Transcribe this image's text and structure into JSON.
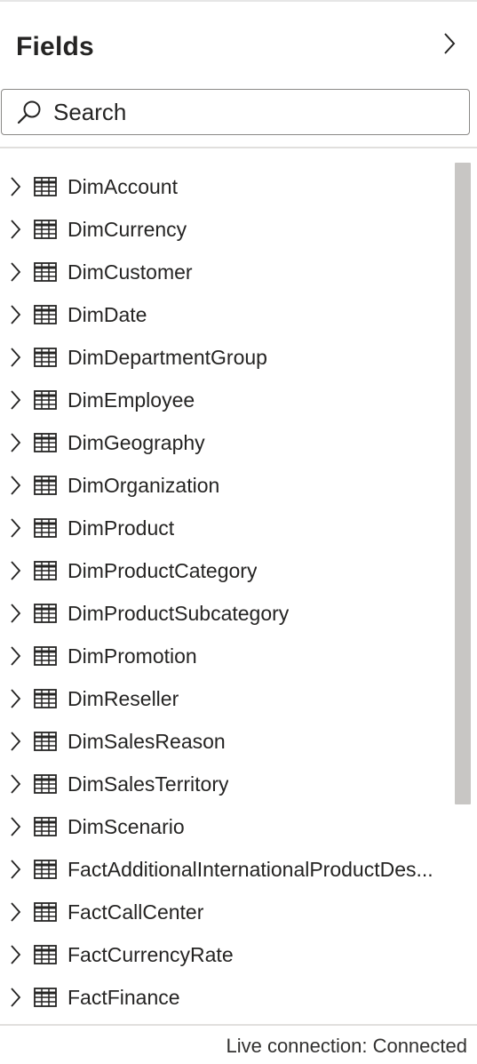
{
  "pane": {
    "title": "Fields",
    "collapse_icon": "chevron-right-icon"
  },
  "search": {
    "placeholder": "Search",
    "icon": "search-icon"
  },
  "tables": [
    {
      "name": "DimAccount"
    },
    {
      "name": "DimCurrency"
    },
    {
      "name": "DimCustomer"
    },
    {
      "name": "DimDate"
    },
    {
      "name": "DimDepartmentGroup"
    },
    {
      "name": "DimEmployee"
    },
    {
      "name": "DimGeography"
    },
    {
      "name": "DimOrganization"
    },
    {
      "name": "DimProduct"
    },
    {
      "name": "DimProductCategory"
    },
    {
      "name": "DimProductSubcategory"
    },
    {
      "name": "DimPromotion"
    },
    {
      "name": "DimReseller"
    },
    {
      "name": "DimSalesReason"
    },
    {
      "name": "DimSalesTerritory"
    },
    {
      "name": "DimScenario"
    },
    {
      "name": "FactAdditionalInternationalProductDes..."
    },
    {
      "name": "FactCallCenter"
    },
    {
      "name": "FactCurrencyRate"
    },
    {
      "name": "FactFinance"
    }
  ],
  "status": {
    "text": "Live connection: Connected"
  },
  "colors": {
    "text": "#252423",
    "border": "#8a8886",
    "scrollbar": "#c8c6c4",
    "divider": "#e1dfdd"
  }
}
